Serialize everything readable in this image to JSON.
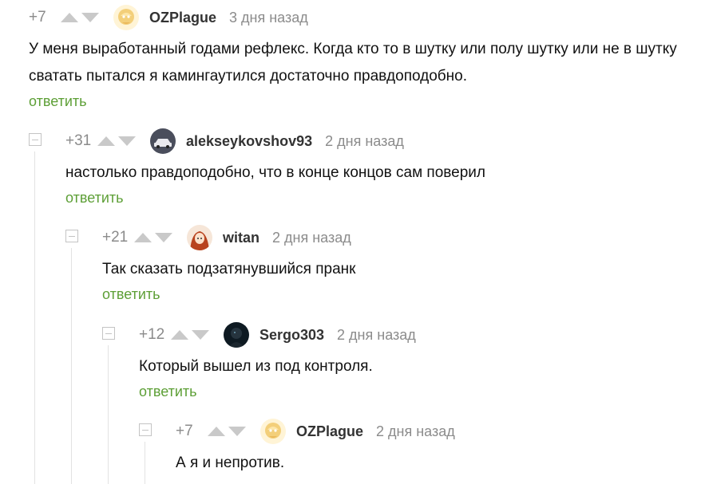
{
  "comments": [
    {
      "rating": "+7",
      "author": "OZPlague",
      "time": "3 дня назад",
      "text": "У меня выработанный годами рефлекс. Когда кто то в шутку или полу шутку или не в шутку сватать пытался я камингаутился достаточно правдоподобно.",
      "reply": "ответить",
      "avatar": "avatar-plague"
    },
    {
      "rating": "+31",
      "author": "alekseykovshov93",
      "time": "2 дня назад",
      "text": "настолько правдоподобно, что в конце концов сам поверил",
      "reply": "ответить",
      "avatar": "avatar-car"
    },
    {
      "rating": "+21",
      "author": "witan",
      "time": "2 дня назад",
      "text": "Так сказать подзатянувшийся пранк",
      "reply": "ответить",
      "avatar": "avatar-anime"
    },
    {
      "rating": "+12",
      "author": "Sergo303",
      "time": "2 дня назад",
      "text": "Который вышел из под контроля.",
      "reply": "ответить",
      "avatar": "avatar-dark"
    },
    {
      "rating": "+7",
      "author": "OZPlague",
      "time": "2 дня назад",
      "text": "А я и непротив.",
      "reply": "",
      "avatar": "avatar-plague"
    }
  ],
  "colors": {
    "reply": "#5d9f36",
    "meta": "#8b8b8b",
    "author": "#333333"
  }
}
